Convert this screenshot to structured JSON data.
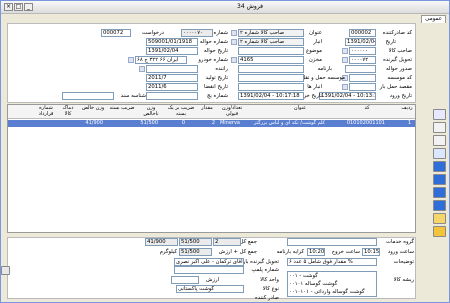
{
  "window": {
    "title": "فروش 34"
  },
  "tab": {
    "label": "عمومی"
  },
  "header": {
    "doc_code_label": "کد صادرکننده",
    "doc_code": "000002",
    "date_label": "تاریخ",
    "date": "1391/02/04",
    "customer_label": "صاحب کالا",
    "customer": "۰۰۰۰۰۰",
    "receiver_label": "تحویل گیرنده",
    "receiver": "۰۰۰۰۷۲",
    "deliverer_label": "صدور حواله",
    "number_label": "شماره",
    "number": "۰۰۰۰۰۷۰",
    "request_label": "درخواست",
    "request": "000072",
    "remittance_label": "شماره حواله",
    "remittance": "509001/01/1918",
    "remittance_date_label": "تاریخ حواله",
    "remittance_date": "1391/02/04",
    "warehouse_label": "انبار",
    "warehouse": "صاحب کالا شماره ۲",
    "vehicle_label": "شماره خودرو",
    "vehicle": "ایران ۶۶ ۳۲۲ ج ۶۸",
    "item_label": "مخزن",
    "item": "4165",
    "waybill_label": "بارنامه",
    "company_label": "موسسه حمل و نقل",
    "company_code": "کد موسسه",
    "driver_label": "راننده",
    "prod_date_label": "تاریخ تولید",
    "prod_date": "2011/7",
    "exp_date_label": "تاریخ انقضا",
    "exp_date": "2011/6",
    "subject_label": "موضوع",
    "store_label": "انبار ها",
    "dest_label": "مقصد حمل بار",
    "batch_label": "شماره بچ",
    "shipment_label": "شناسه سند",
    "entry_date_label": "تاریخ ورود",
    "entry_date": "1391/02/04 - 10:13:15",
    "exit_date_label": "تاریخ خروج",
    "exit_date": "1391/02/04 - 10:17:18",
    "header_title_label": "عنوان",
    "header_title": "صاحب کالا شماره ۲"
  },
  "grid": {
    "columns": [
      "ردیف",
      "کد",
      "عنوان",
      "تعداد/وزن قبولی",
      "مقدار",
      "ضریب بر یک بسته",
      "وزن ناخالص",
      "ضریب بسته",
      "وزن خالص",
      "دماک کالا",
      "شماره قرارداد"
    ],
    "rows": [
      {
        "row": "1",
        "code": "010102001101",
        "title": "کلم گوشت/ تکه ای و لباس بزرگتر",
        "qty": "Minerva",
        "count": "2",
        "unit": "0",
        "gross": "51/500",
        "pack": "41/900",
        "net": ""
      }
    ]
  },
  "footer": {
    "total_qty_label": "جمع کل",
    "total_qty": "2",
    "total_gross": "51/500",
    "total_net": "41/900",
    "kg_label": "کیلوگرم",
    "total_label": "جمع کل + ارزش",
    "total_value": "51/500",
    "services_label": "گروه خدمات",
    "services": "",
    "entry_time_label": "ساعت ورود",
    "entry_time": "10:15",
    "exit_time_label": "ساعت خروج",
    "exit_time": "10:20",
    "invoice_label": "کرایه بارنامه",
    "desc_label": "توضیحات",
    "desc": "مقدار فوق شامل ۵ عدد ۶ %",
    "deliverer_label": "تحویل گیرنده بار",
    "deliverer": "آقای ترکمان - علی اکبر نصری",
    "vessel_label": "شماره پلمپ",
    "item_type_label": "واحد کالا",
    "item_type_prefix": "ارزش",
    "goods_label": "نوع کالا",
    "goods": "گوشت پاکستانی",
    "status_label": "صادر کننده",
    "tree_label": "ریشه کالا",
    "tree": [
      "۰۰۱ - گوشت",
      "۰۰۱۰۱ گوشت گوساله",
      "۰۰۱۰۱۰۱ - گوشت گوساله وارداتی"
    ]
  },
  "colors": {
    "selection": "#5a7fd0",
    "window_bg": "#ece9d8",
    "border": "#7f9db9"
  }
}
